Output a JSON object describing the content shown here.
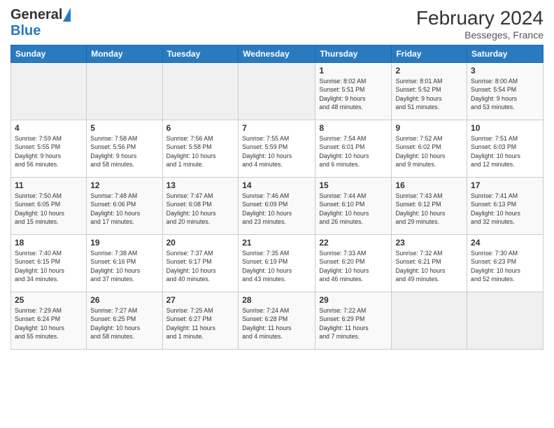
{
  "header": {
    "logo_general": "General",
    "logo_blue": "Blue",
    "month_year": "February 2024",
    "location": "Besseges, France"
  },
  "weekdays": [
    "Sunday",
    "Monday",
    "Tuesday",
    "Wednesday",
    "Thursday",
    "Friday",
    "Saturday"
  ],
  "weeks": [
    [
      {
        "day": "",
        "info": ""
      },
      {
        "day": "",
        "info": ""
      },
      {
        "day": "",
        "info": ""
      },
      {
        "day": "",
        "info": ""
      },
      {
        "day": "1",
        "info": "Sunrise: 8:02 AM\nSunset: 5:51 PM\nDaylight: 9 hours\nand 48 minutes."
      },
      {
        "day": "2",
        "info": "Sunrise: 8:01 AM\nSunset: 5:52 PM\nDaylight: 9 hours\nand 51 minutes."
      },
      {
        "day": "3",
        "info": "Sunrise: 8:00 AM\nSunset: 5:54 PM\nDaylight: 9 hours\nand 53 minutes."
      }
    ],
    [
      {
        "day": "4",
        "info": "Sunrise: 7:59 AM\nSunset: 5:55 PM\nDaylight: 9 hours\nand 56 minutes."
      },
      {
        "day": "5",
        "info": "Sunrise: 7:58 AM\nSunset: 5:56 PM\nDaylight: 9 hours\nand 58 minutes."
      },
      {
        "day": "6",
        "info": "Sunrise: 7:56 AM\nSunset: 5:58 PM\nDaylight: 10 hours\nand 1 minute."
      },
      {
        "day": "7",
        "info": "Sunrise: 7:55 AM\nSunset: 5:59 PM\nDaylight: 10 hours\nand 4 minutes."
      },
      {
        "day": "8",
        "info": "Sunrise: 7:54 AM\nSunset: 6:01 PM\nDaylight: 10 hours\nand 6 minutes."
      },
      {
        "day": "9",
        "info": "Sunrise: 7:52 AM\nSunset: 6:02 PM\nDaylight: 10 hours\nand 9 minutes."
      },
      {
        "day": "10",
        "info": "Sunrise: 7:51 AM\nSunset: 6:03 PM\nDaylight: 10 hours\nand 12 minutes."
      }
    ],
    [
      {
        "day": "11",
        "info": "Sunrise: 7:50 AM\nSunset: 6:05 PM\nDaylight: 10 hours\nand 15 minutes."
      },
      {
        "day": "12",
        "info": "Sunrise: 7:48 AM\nSunset: 6:06 PM\nDaylight: 10 hours\nand 17 minutes."
      },
      {
        "day": "13",
        "info": "Sunrise: 7:47 AM\nSunset: 6:08 PM\nDaylight: 10 hours\nand 20 minutes."
      },
      {
        "day": "14",
        "info": "Sunrise: 7:46 AM\nSunset: 6:09 PM\nDaylight: 10 hours\nand 23 minutes."
      },
      {
        "day": "15",
        "info": "Sunrise: 7:44 AM\nSunset: 6:10 PM\nDaylight: 10 hours\nand 26 minutes."
      },
      {
        "day": "16",
        "info": "Sunrise: 7:43 AM\nSunset: 6:12 PM\nDaylight: 10 hours\nand 29 minutes."
      },
      {
        "day": "17",
        "info": "Sunrise: 7:41 AM\nSunset: 6:13 PM\nDaylight: 10 hours\nand 32 minutes."
      }
    ],
    [
      {
        "day": "18",
        "info": "Sunrise: 7:40 AM\nSunset: 6:15 PM\nDaylight: 10 hours\nand 34 minutes."
      },
      {
        "day": "19",
        "info": "Sunrise: 7:38 AM\nSunset: 6:16 PM\nDaylight: 10 hours\nand 37 minutes."
      },
      {
        "day": "20",
        "info": "Sunrise: 7:37 AM\nSunset: 6:17 PM\nDaylight: 10 hours\nand 40 minutes."
      },
      {
        "day": "21",
        "info": "Sunrise: 7:35 AM\nSunset: 6:19 PM\nDaylight: 10 hours\nand 43 minutes."
      },
      {
        "day": "22",
        "info": "Sunrise: 7:33 AM\nSunset: 6:20 PM\nDaylight: 10 hours\nand 46 minutes."
      },
      {
        "day": "23",
        "info": "Sunrise: 7:32 AM\nSunset: 6:21 PM\nDaylight: 10 hours\nand 49 minutes."
      },
      {
        "day": "24",
        "info": "Sunrise: 7:30 AM\nSunset: 6:23 PM\nDaylight: 10 hours\nand 52 minutes."
      }
    ],
    [
      {
        "day": "25",
        "info": "Sunrise: 7:29 AM\nSunset: 6:24 PM\nDaylight: 10 hours\nand 55 minutes."
      },
      {
        "day": "26",
        "info": "Sunrise: 7:27 AM\nSunset: 6:25 PM\nDaylight: 10 hours\nand 58 minutes."
      },
      {
        "day": "27",
        "info": "Sunrise: 7:25 AM\nSunset: 6:27 PM\nDaylight: 11 hours\nand 1 minute."
      },
      {
        "day": "28",
        "info": "Sunrise: 7:24 AM\nSunset: 6:28 PM\nDaylight: 11 hours\nand 4 minutes."
      },
      {
        "day": "29",
        "info": "Sunrise: 7:22 AM\nSunset: 6:29 PM\nDaylight: 11 hours\nand 7 minutes."
      },
      {
        "day": "",
        "info": ""
      },
      {
        "day": "",
        "info": ""
      }
    ]
  ]
}
